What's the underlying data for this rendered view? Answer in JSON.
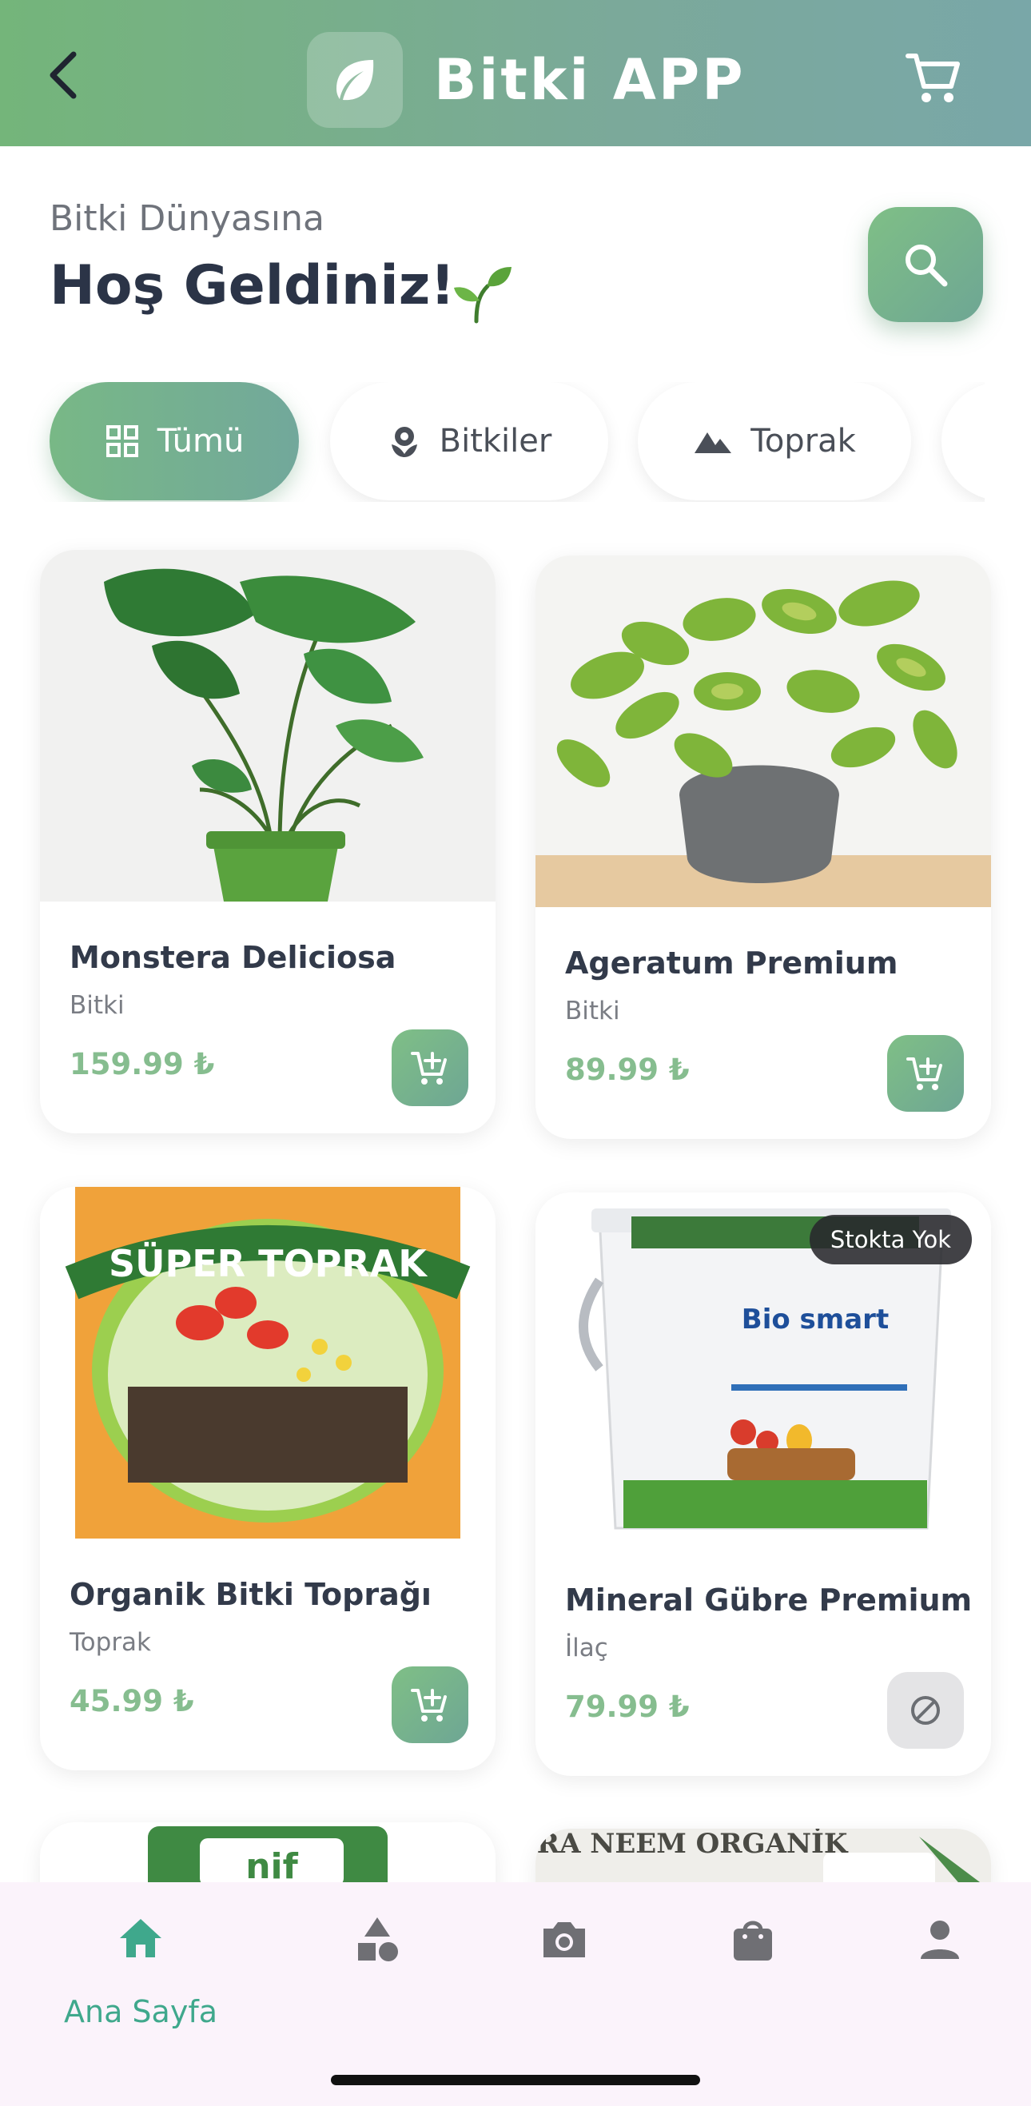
{
  "header": {
    "app_title": "Bitki APP",
    "icons": [
      "back-icon",
      "leaf-icon",
      "cart-icon"
    ],
    "gradient": [
      "#74b57a",
      "#79a7a8"
    ]
  },
  "greeting": {
    "subtitle": "Bitki Dünyasına",
    "title": "Hoş Geldiniz!",
    "emoji_icon": "sprout-icon"
  },
  "search": {
    "icon": "search-icon"
  },
  "categories": [
    {
      "label": "Tümü",
      "icon": "grid-icon",
      "active": true
    },
    {
      "label": "Bitkiler",
      "icon": "flower-icon",
      "active": false
    },
    {
      "label": "Toprak",
      "icon": "mountain-icon",
      "active": false
    }
  ],
  "products": [
    {
      "name": "Monstera Deliciosa",
      "category": "Bitki",
      "price": "159.99 ₺",
      "in_stock": true
    },
    {
      "name": "Ageratum Premium",
      "category": "Bitki",
      "price": "89.99 ₺",
      "in_stock": true
    },
    {
      "name": "Organik Bitki Toprağı",
      "category": "Toprak",
      "price": "45.99 ₺",
      "in_stock": true,
      "package_text": "SÜPER TOPRAK"
    },
    {
      "name": "Mineral Gübre Premium",
      "category": "İlaç",
      "price": "79.99 ₺",
      "in_stock": false,
      "badge": "Stokta Yok",
      "package_text": "Bio smart"
    },
    {
      "package_text": "nif"
    },
    {
      "package_text": "VERA NEEM ORGANİK"
    }
  ],
  "bottom_nav": [
    {
      "label": "Ana Sayfa",
      "icon": "home-icon",
      "active": true
    },
    {
      "label": "",
      "icon": "categories-icon",
      "active": false
    },
    {
      "label": "",
      "icon": "camera-icon",
      "active": false
    },
    {
      "label": "",
      "icon": "shopping-bag-icon",
      "active": false
    },
    {
      "label": "",
      "icon": "profile-icon",
      "active": false
    }
  ],
  "colors": {
    "accent": "#7ab98a",
    "price": "#86bd8f",
    "nav_active": "#3fa88c"
  }
}
